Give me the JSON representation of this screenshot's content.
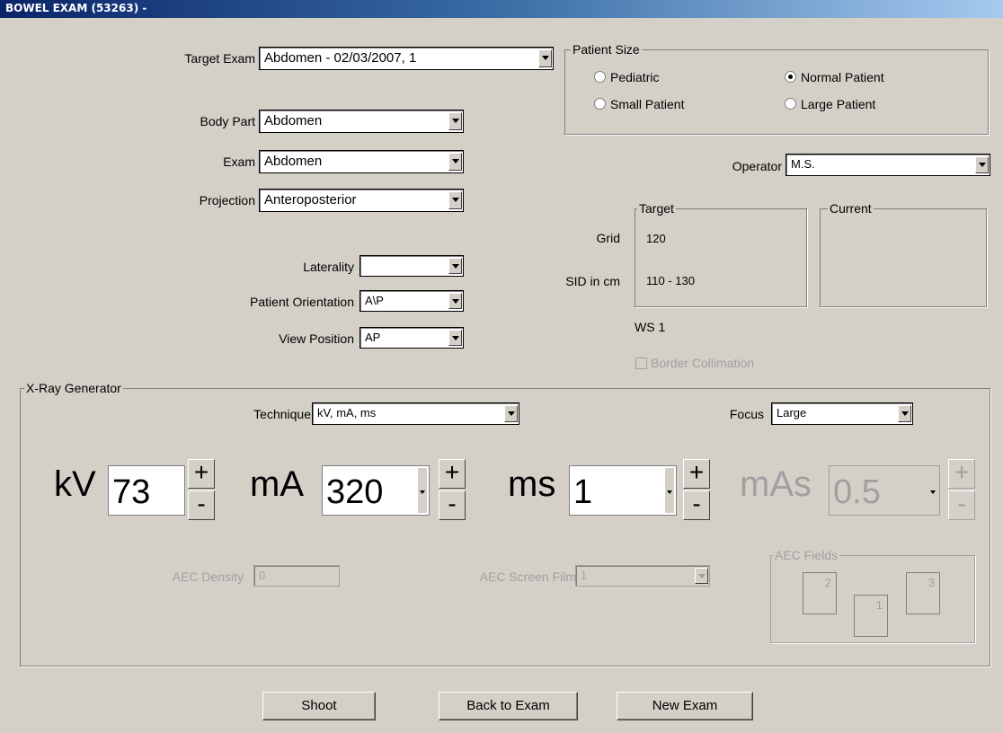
{
  "window": {
    "title": "BOWEL EXAM (53263) -"
  },
  "exam": {
    "target_exam_label": "Target Exam",
    "target_exam_value": "Abdomen - 02/03/2007, 1",
    "body_part_label": "Body Part",
    "body_part_value": "Abdomen",
    "exam_label": "Exam",
    "exam_value": "Abdomen",
    "projection_label": "Projection",
    "projection_value": "Anteroposterior",
    "laterality_label": "Laterality",
    "laterality_value": "",
    "orientation_label": "Patient Orientation",
    "orientation_value": "A\\P",
    "view_position_label": "View Position",
    "view_position_value": "AP"
  },
  "patient_size": {
    "title": "Patient Size",
    "options": [
      "Pediatric",
      "Normal Patient",
      "Small Patient",
      "Large Patient"
    ],
    "selected": "Normal Patient"
  },
  "operator": {
    "label": "Operator",
    "value": "M.S."
  },
  "geometry": {
    "target_title": "Target",
    "current_title": "Current",
    "grid_label": "Grid",
    "grid_value": "120",
    "sid_label": "SID in cm",
    "sid_value": "110 - 130",
    "ws": "WS 1",
    "border_collimation": "Border Collimation"
  },
  "generator": {
    "title": "X-Ray Generator",
    "technique_label": "Technique",
    "technique_value": "kV, mA, ms",
    "focus_label": "Focus",
    "focus_value": "Large",
    "kv_label": "kV",
    "kv_value": "73",
    "ma_label": "mA",
    "ma_value": "320",
    "ms_label": "ms",
    "ms_value": "1",
    "mas_label": "mAs",
    "mas_value": "0.5",
    "plus": "+",
    "minus": "-",
    "aec_density_label": "AEC Density",
    "aec_density_value": "0",
    "aec_film_label": "AEC Screen Film",
    "aec_film_value": "1",
    "aec_fields_title": "AEC Fields",
    "aec_fields": [
      "2",
      "1",
      "3"
    ]
  },
  "buttons": {
    "shoot": "Shoot",
    "back": "Back to Exam",
    "new": "New Exam"
  }
}
